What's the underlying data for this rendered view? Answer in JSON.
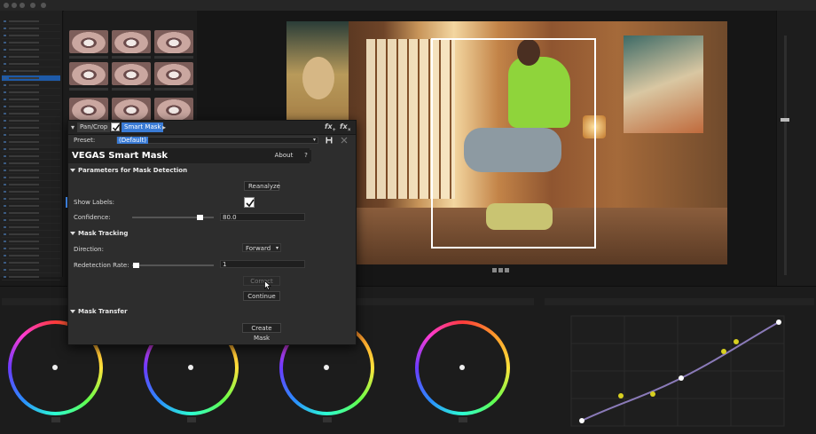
{
  "dialog": {
    "tabs": {
      "pancrop": "Pan/Crop",
      "smartmask": "Smart Mask"
    },
    "fx_add_label": "fx",
    "fx_remove_label": "fx",
    "preset_label": "Preset:",
    "preset_value": "(Default)",
    "title": "VEGAS Smart Mask",
    "about_label": "About",
    "help_label": "?",
    "sections": {
      "detection": "Parameters for Mask Detection",
      "tracking": "Mask Tracking",
      "transfer": "Mask Transfer"
    },
    "reanalyze_label": "Reanalyze",
    "show_labels_label": "Show Labels:",
    "show_labels_checked": true,
    "confidence_label": "Confidence:",
    "confidence_value": "80.0",
    "direction_label": "Direction:",
    "direction_value": "Forward",
    "redetection_label": "Redetection Rate:",
    "redetection_value": "1",
    "correct_mask_label": "Correct Mas",
    "continue_label": "Continue Tr",
    "create_mask_label": "Create Mask"
  },
  "icons": {
    "save": "save-icon",
    "close": "close-icon",
    "dropdown": "chevron-down-icon",
    "fx_add": "fx-add-icon",
    "fx_remove": "fx-remove-icon"
  },
  "colors": {
    "accent": "#3a7bd5",
    "dialog_bg": "#2d2d2d",
    "mask_outline": "#ffffff"
  }
}
